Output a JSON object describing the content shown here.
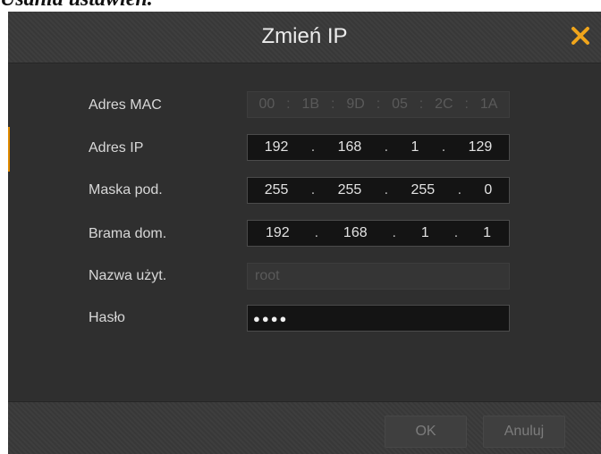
{
  "background_text": "Usania ustawień.",
  "dialog": {
    "title": "Zmień IP",
    "close_icon": "close-icon",
    "accent_color": "#e08a00"
  },
  "fields": {
    "mac": {
      "label": "Adres MAC",
      "segments": [
        "00",
        "1B",
        "9D",
        "05",
        "2C",
        "1A"
      ],
      "separator": ":"
    },
    "ip": {
      "label": "Adres IP",
      "segments": [
        "192",
        "168",
        "1",
        "129"
      ],
      "separator": "."
    },
    "mask": {
      "label": "Maska pod.",
      "segments": [
        "255",
        "255",
        "255",
        "0"
      ],
      "separator": "."
    },
    "gateway": {
      "label": "Brama dom.",
      "segments": [
        "192",
        "168",
        "1",
        "1"
      ],
      "separator": "."
    },
    "username": {
      "label": "Nazwa użyt.",
      "value": "root"
    },
    "password": {
      "label": "Hasło",
      "value": "●●●●"
    }
  },
  "buttons": {
    "ok": "OK",
    "cancel": "Anuluj"
  }
}
